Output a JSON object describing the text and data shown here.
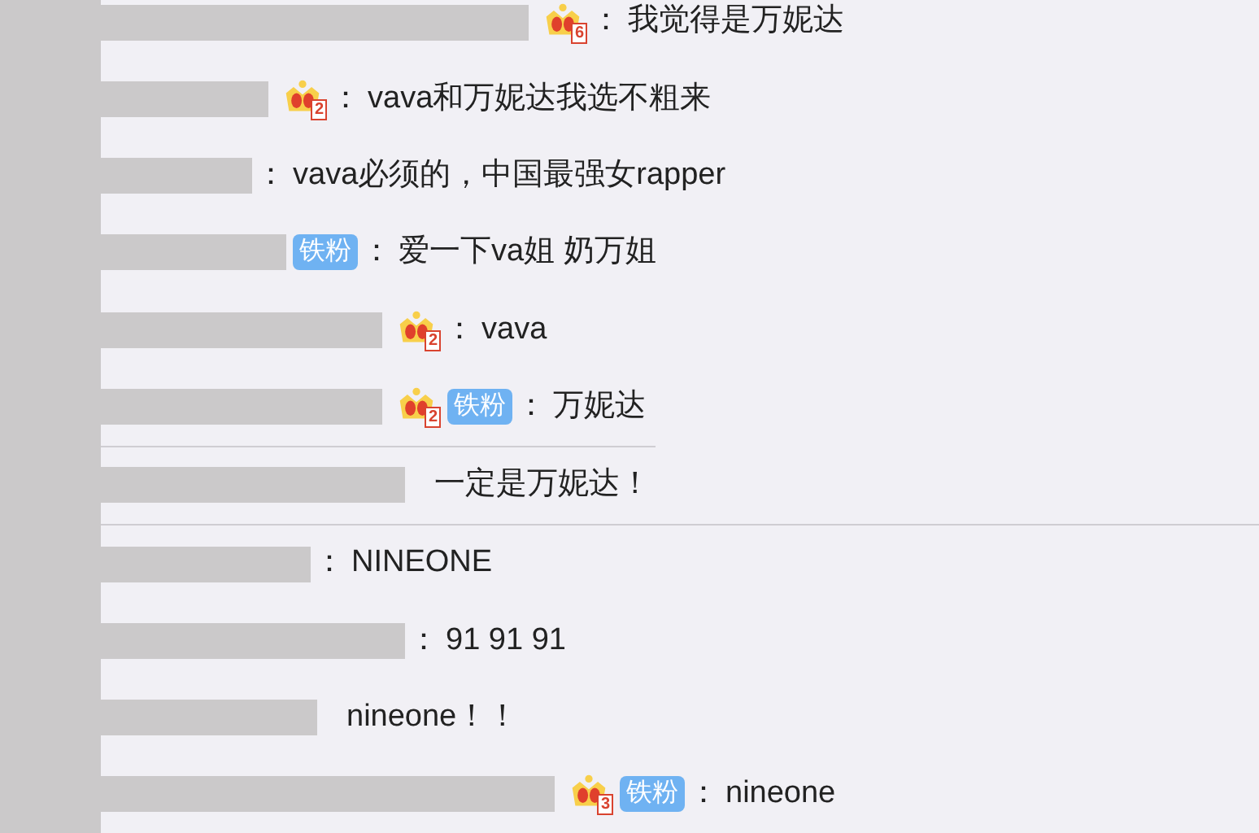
{
  "comments": [
    {
      "kind": "plain",
      "badge": "6",
      "colon": "：",
      "text": "我觉得是万妮达"
    },
    {
      "kind": "plain",
      "badge": "2",
      "colon": "：",
      "text": "vava和万妮达我选不粗来"
    },
    {
      "kind": "plain",
      "colon": "：",
      "text": "vava必须的，中国最强女rapper"
    },
    {
      "kind": "plain",
      "tag": "铁粉",
      "colon": "：",
      "text": "爱一下va姐 奶万姐"
    },
    {
      "kind": "plain",
      "badge": "2",
      "colon": "：",
      "text": "vava"
    },
    {
      "kind": "shortrule",
      "badge": "2",
      "tag": "铁粉",
      "colon": "：",
      "text": "万妮达"
    },
    {
      "kind": "fullrule",
      "text": "一定是万妮达！"
    },
    {
      "kind": "plain",
      "colon": "：",
      "text": "NINEONE"
    },
    {
      "kind": "plain",
      "colon": "：",
      "text": "91 91 91"
    },
    {
      "kind": "plain",
      "text": "nineone！！"
    },
    {
      "kind": "plain",
      "badge": "3",
      "tag": "铁粉",
      "colon": "：",
      "text": "nineone"
    }
  ]
}
